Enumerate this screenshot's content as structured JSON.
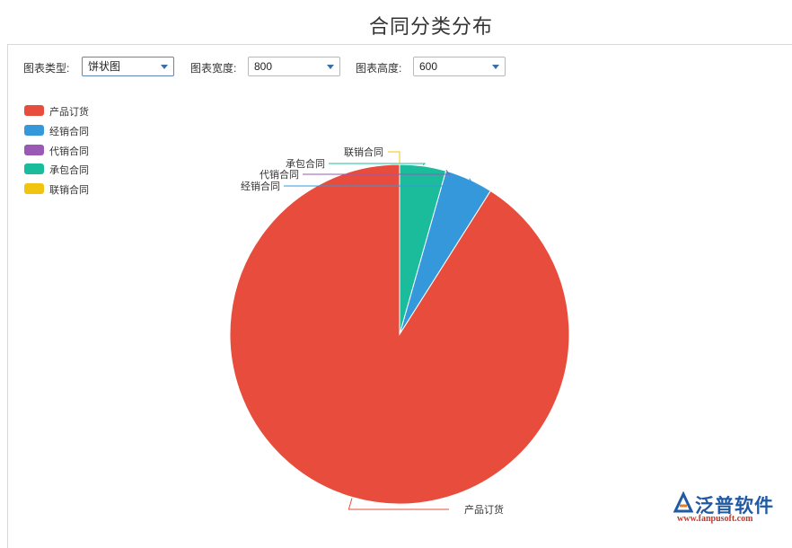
{
  "page": {
    "title": "合同分类分布"
  },
  "toolbar": {
    "type_label": "图表类型:",
    "type_value": "饼状图",
    "width_label": "图表宽度:",
    "width_value": "800",
    "height_label": "图表高度:",
    "height_value": "600"
  },
  "chart_data": {
    "type": "pie",
    "title": "",
    "legend_position": "top-left",
    "series": [
      {
        "name": "产品订货",
        "value": 91.0,
        "color": "#e74c3c"
      },
      {
        "name": "经销合同",
        "value": 4.6,
        "color": "#3498db"
      },
      {
        "name": "代销合同",
        "value": 0.0,
        "color": "#9b59b6"
      },
      {
        "name": "承包合同",
        "value": 4.4,
        "color": "#1abc9c"
      },
      {
        "name": "联销合同",
        "value": 0.0,
        "color": "#f1c40f"
      }
    ]
  },
  "logo": {
    "brand": "泛普软件",
    "url": "www.fanpusoft.com",
    "icon": "fanpu-logo-icon"
  }
}
